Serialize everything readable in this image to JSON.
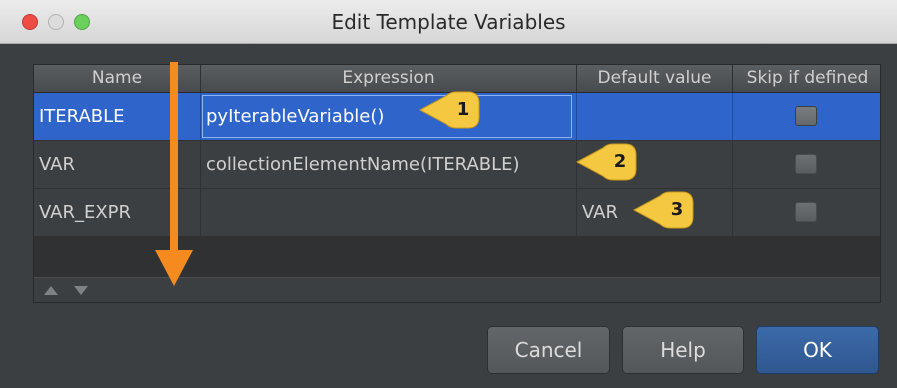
{
  "window": {
    "title": "Edit Template Variables"
  },
  "table": {
    "columns": [
      "Name",
      "Expression",
      "Default value",
      "Skip if defined"
    ],
    "rows": [
      {
        "name": "ITERABLE",
        "expression": "pyIterableVariable()",
        "default_value": "",
        "skip_if_defined": false,
        "selected": true
      },
      {
        "name": "VAR",
        "expression": "collectionElementName(ITERABLE)",
        "default_value": "",
        "skip_if_defined": false,
        "selected": false
      },
      {
        "name": "VAR_EXPR",
        "expression": "",
        "default_value": "VAR",
        "skip_if_defined": false,
        "selected": false
      }
    ]
  },
  "controls": {
    "move_up": "up-triangle-icon",
    "move_down": "down-triangle-icon"
  },
  "buttons": {
    "cancel": "Cancel",
    "help": "Help",
    "ok": "OK"
  },
  "annotations": {
    "callouts": [
      "1",
      "2",
      "3"
    ],
    "callout_color": "#f5c842",
    "arrow_color": "#f58a1f"
  },
  "colors": {
    "selection": "#2f65ca",
    "background": "#3c3f41",
    "ok_button": "#3c6aaa"
  }
}
